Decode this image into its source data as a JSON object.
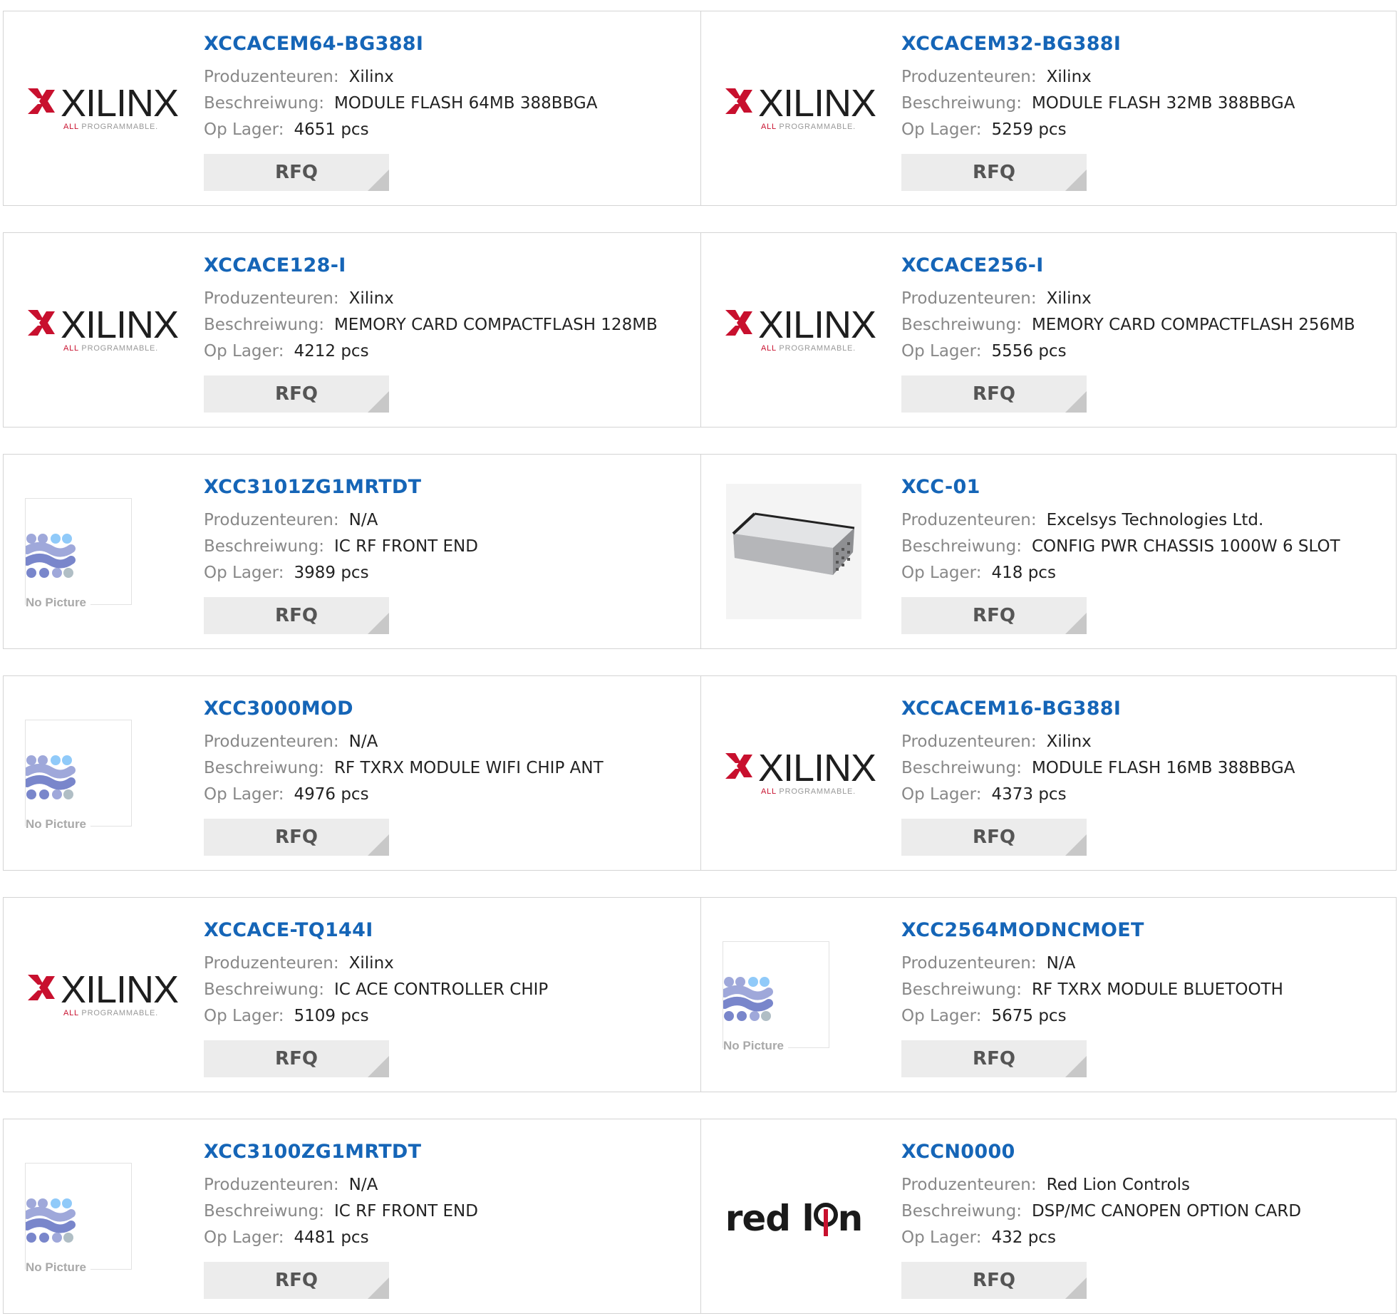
{
  "labels": {
    "manufacturer": "Produzenteuren:",
    "description": "Beschreiwung:",
    "stock": "Op Lager:",
    "rfq": "RFQ"
  },
  "logos": {
    "xilinx_name": "XILINX",
    "xilinx_sub_a": "ALL",
    "xilinx_sub_b": " PROGRAMMABLE.",
    "no_picture": "No Picture",
    "redlion_a": "red l",
    "redlion_b": "n"
  },
  "colors": {
    "link": "#1565b7",
    "xilinx_red": "#c8102e",
    "button_bg": "#ececec"
  },
  "products": [
    {
      "part": "XCCACEM64-BG388I",
      "manufacturer": "Xilinx",
      "description": "MODULE FLASH 64MB 388BBGA",
      "stock": "4651 pcs",
      "image": "xilinx-logo"
    },
    {
      "part": "XCCACEM32-BG388I",
      "manufacturer": "Xilinx",
      "description": "MODULE FLASH 32MB 388BBGA",
      "stock": "5259 pcs",
      "image": "xilinx-logo"
    },
    {
      "part": "XCCACE128-I",
      "manufacturer": "Xilinx",
      "description": "MEMORY CARD COMPACTFLASH 128MB",
      "stock": "4212 pcs",
      "image": "xilinx-logo"
    },
    {
      "part": "XCCACE256-I",
      "manufacturer": "Xilinx",
      "description": "MEMORY CARD COMPACTFLASH 256MB",
      "stock": "5556 pcs",
      "image": "xilinx-logo"
    },
    {
      "part": "XCC3101ZG1MRTDT",
      "manufacturer": "N/A",
      "description": "IC RF FRONT END",
      "stock": "3989 pcs",
      "image": "no-picture"
    },
    {
      "part": "XCC-01",
      "manufacturer": "Excelsys Technologies Ltd.",
      "description": "CONFIG PWR CHASSIS 1000W 6 SLOT",
      "stock": "418 pcs",
      "image": "chassis-photo"
    },
    {
      "part": "XCC3000MOD",
      "manufacturer": "N/A",
      "description": "RF TXRX MODULE WIFI CHIP ANT",
      "stock": "4976 pcs",
      "image": "no-picture"
    },
    {
      "part": "XCCACEM16-BG388I",
      "manufacturer": "Xilinx",
      "description": "MODULE FLASH 16MB 388BBGA",
      "stock": "4373 pcs",
      "image": "xilinx-logo"
    },
    {
      "part": "XCCACE-TQ144I",
      "manufacturer": "Xilinx",
      "description": "IC ACE CONTROLLER CHIP",
      "stock": "5109 pcs",
      "image": "xilinx-logo"
    },
    {
      "part": "XCC2564MODNCMOET",
      "manufacturer": "N/A",
      "description": "RF TXRX MODULE BLUETOOTH",
      "stock": "5675 pcs",
      "image": "no-picture"
    },
    {
      "part": "XCC3100ZG1MRTDT",
      "manufacturer": "N/A",
      "description": "IC RF FRONT END",
      "stock": "4481 pcs",
      "image": "no-picture"
    },
    {
      "part": "XCCN0000",
      "manufacturer": "Red Lion Controls",
      "description": "DSP/MC CANOPEN OPTION CARD",
      "stock": "432 pcs",
      "image": "redlion-logo"
    }
  ]
}
